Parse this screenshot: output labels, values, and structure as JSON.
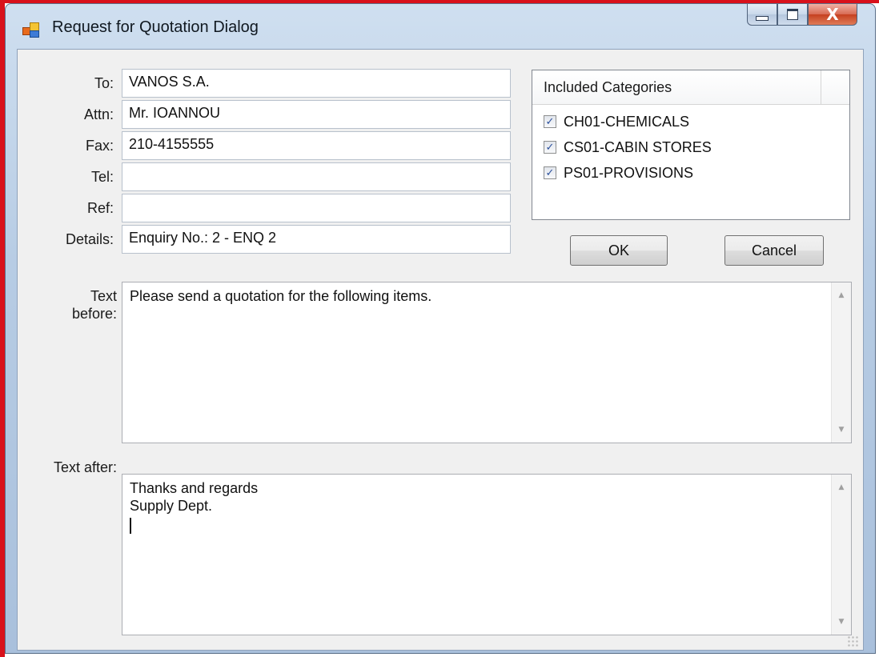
{
  "window": {
    "title": "Request for Quotation Dialog",
    "close_glyph": "X"
  },
  "form": {
    "to_label": "To:",
    "to_value": "VANOS S.A.",
    "attn_label": "Attn:",
    "attn_value": "Mr. IOANNOU",
    "fax_label": "Fax:",
    "fax_value": "210-4155555",
    "tel_label": "Tel:",
    "tel_value": "",
    "ref_label": "Ref:",
    "ref_value": "",
    "details_label": "Details:",
    "details_value": "Enquiry No.: 2 - ENQ 2"
  },
  "categories": {
    "header": "Included Categories",
    "items": [
      {
        "label": "CH01-CHEMICALS",
        "checked": true
      },
      {
        "label": "CS01-CABIN STORES",
        "checked": true
      },
      {
        "label": "PS01-PROVISIONS",
        "checked": true
      }
    ]
  },
  "buttons": {
    "ok": "OK",
    "cancel": "Cancel"
  },
  "text_before": {
    "label_line1": "Text",
    "label_line2": "before:",
    "value": "Please send a quotation for the following items."
  },
  "text_after": {
    "label": "Text after:",
    "line1": "Thanks and regards",
    "line2": "Supply Dept."
  },
  "icons": {
    "check": "✓",
    "scroll_up": "▲",
    "scroll_down": "▼"
  },
  "colors": {
    "accent_red": "#d8111b",
    "title_close": "#c5401f"
  }
}
